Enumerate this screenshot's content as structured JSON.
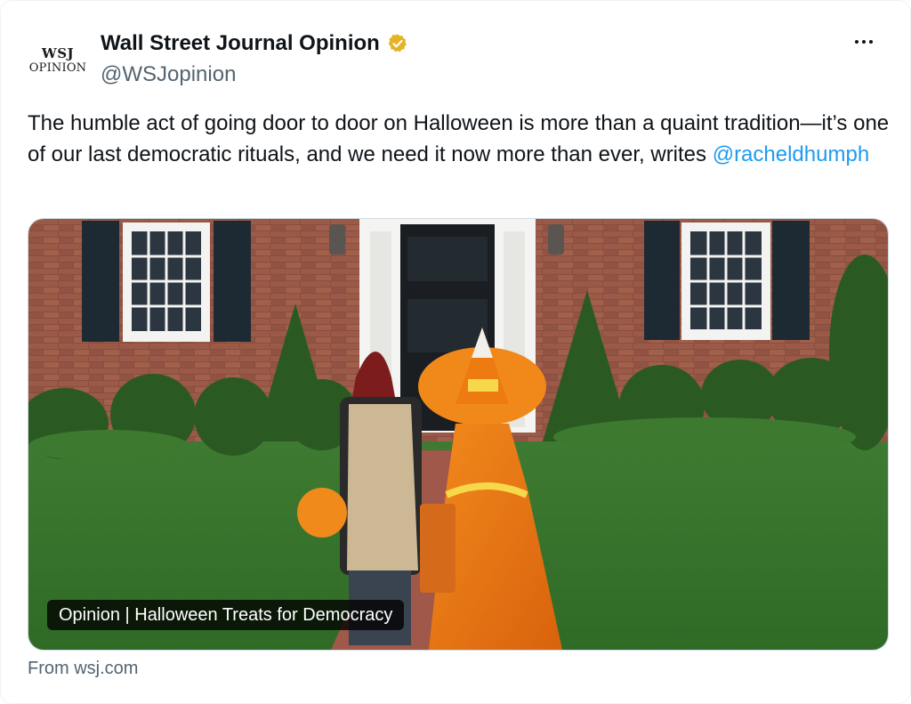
{
  "tweet": {
    "author": {
      "logo_line1": "WSJ",
      "logo_line2": "OPINION",
      "display_name": "Wall Street Journal Opinion",
      "handle": "@WSJopinion",
      "verified": true,
      "verified_color": "#e6b325"
    },
    "text": "The humble act of going door to door on Halloween is more than a quaint tradition—it’s one of our last democratic rituals, and we need it now more than ever, writes ",
    "mention": "@racheldhumph",
    "mention_color": "#1d9bf0",
    "more_icon": "ellipsis-icon"
  },
  "card": {
    "caption": "Opinion | Halloween Treats for Democracy",
    "source": "From wsj.com"
  }
}
